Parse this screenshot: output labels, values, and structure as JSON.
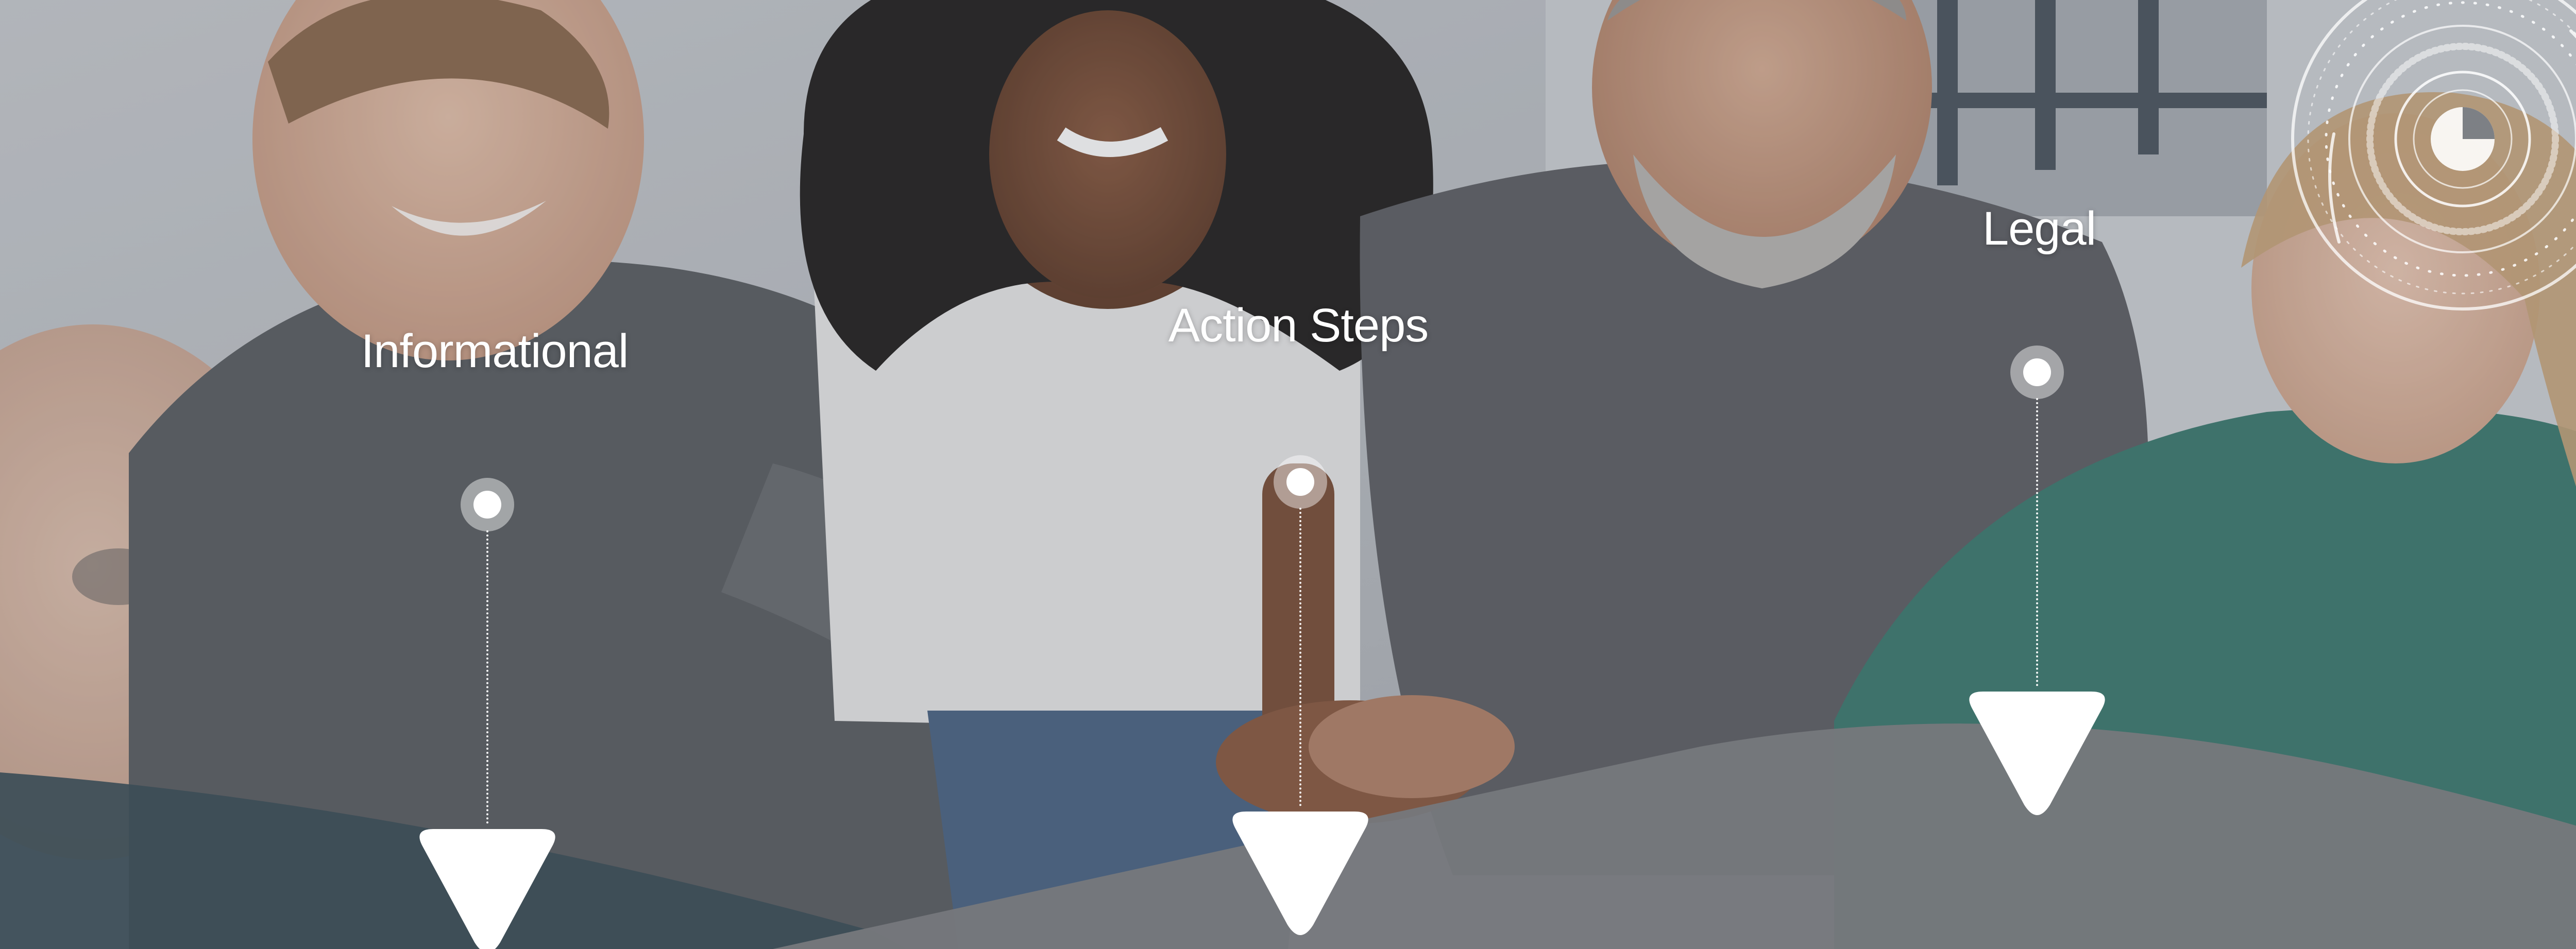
{
  "slide": {
    "steps": [
      {
        "label": "Informational"
      },
      {
        "label": "Action Steps"
      },
      {
        "label": "Legal"
      }
    ]
  },
  "colors": {
    "wave_dark": "#3c4d57",
    "wave_gray": "#76787c",
    "marker": "#ffffff",
    "text": "#ffffff"
  },
  "icons": {
    "decoration": "circular-dial-icon",
    "pin": "location-pin-dot-icon",
    "marker": "rounded-triangle-marker-icon"
  }
}
